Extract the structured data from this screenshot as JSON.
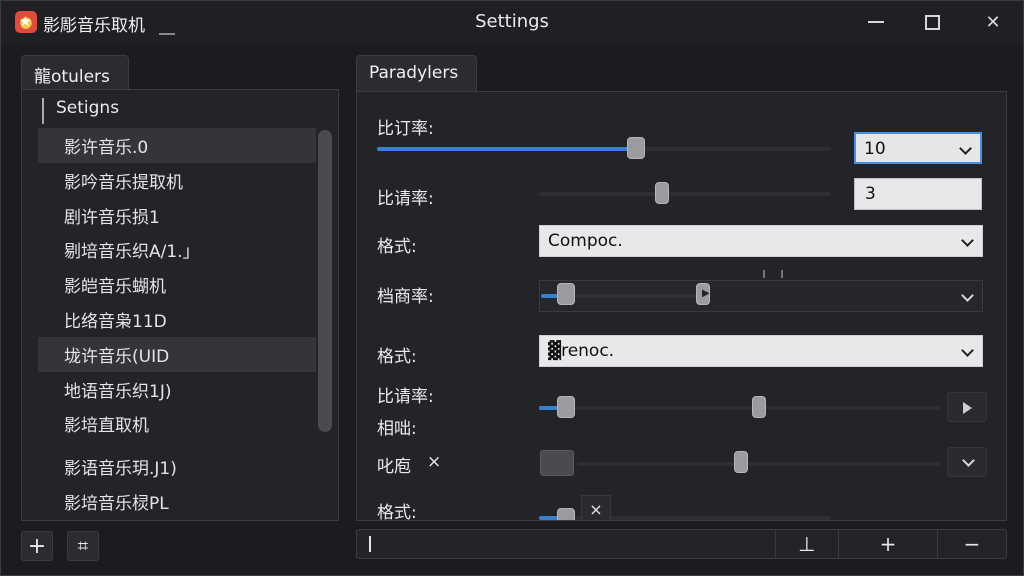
{
  "window": {
    "app_name": "影彫音乐取机",
    "title": "Settings"
  },
  "left": {
    "tab_label": "龍otulers",
    "tree_header": "Setigns",
    "items": [
      "影许音乐.0",
      "影吟音乐提取机",
      "剧许音乐损1",
      "剔培音乐织A/1.」",
      "影皑音乐蝴机",
      "比络音枭11D",
      "垅许音乐(UID",
      "地语音乐织1J)",
      "影培直取机",
      "影语音乐玥.J1)",
      "影培音乐棂PL"
    ],
    "selected_indices": [
      0,
      6
    ],
    "footer_buttons": [
      "+",
      "⌗"
    ]
  },
  "right": {
    "tab_label": "Paradylers",
    "rows": {
      "r1_label": "比订率:",
      "r1_dropdown": "10",
      "r1_slider_level": 0.57,
      "r2_label": "比请率:",
      "r2_input": "3",
      "r2_slider_level": 0.42,
      "r3_label": "格式:",
      "r3_dropdown": "Compoc.",
      "r4_label": "档商率:",
      "r5_label": "格式:",
      "r5_dropdown": "▓renoc.",
      "r6_label_a": "比请率:",
      "r6_label_b": "相咄:",
      "r7_label": "叱庖",
      "r7_clear": "×",
      "r8_label": "格式:",
      "r8_clear": "×"
    }
  },
  "bottom_bar": {
    "btn_a": "⊥",
    "btn_b": "+",
    "btn_c": "−"
  },
  "colors": {
    "accent": "#3b7fd0",
    "window_bg": "#1b1c1f",
    "panel_bg": "#232428"
  }
}
